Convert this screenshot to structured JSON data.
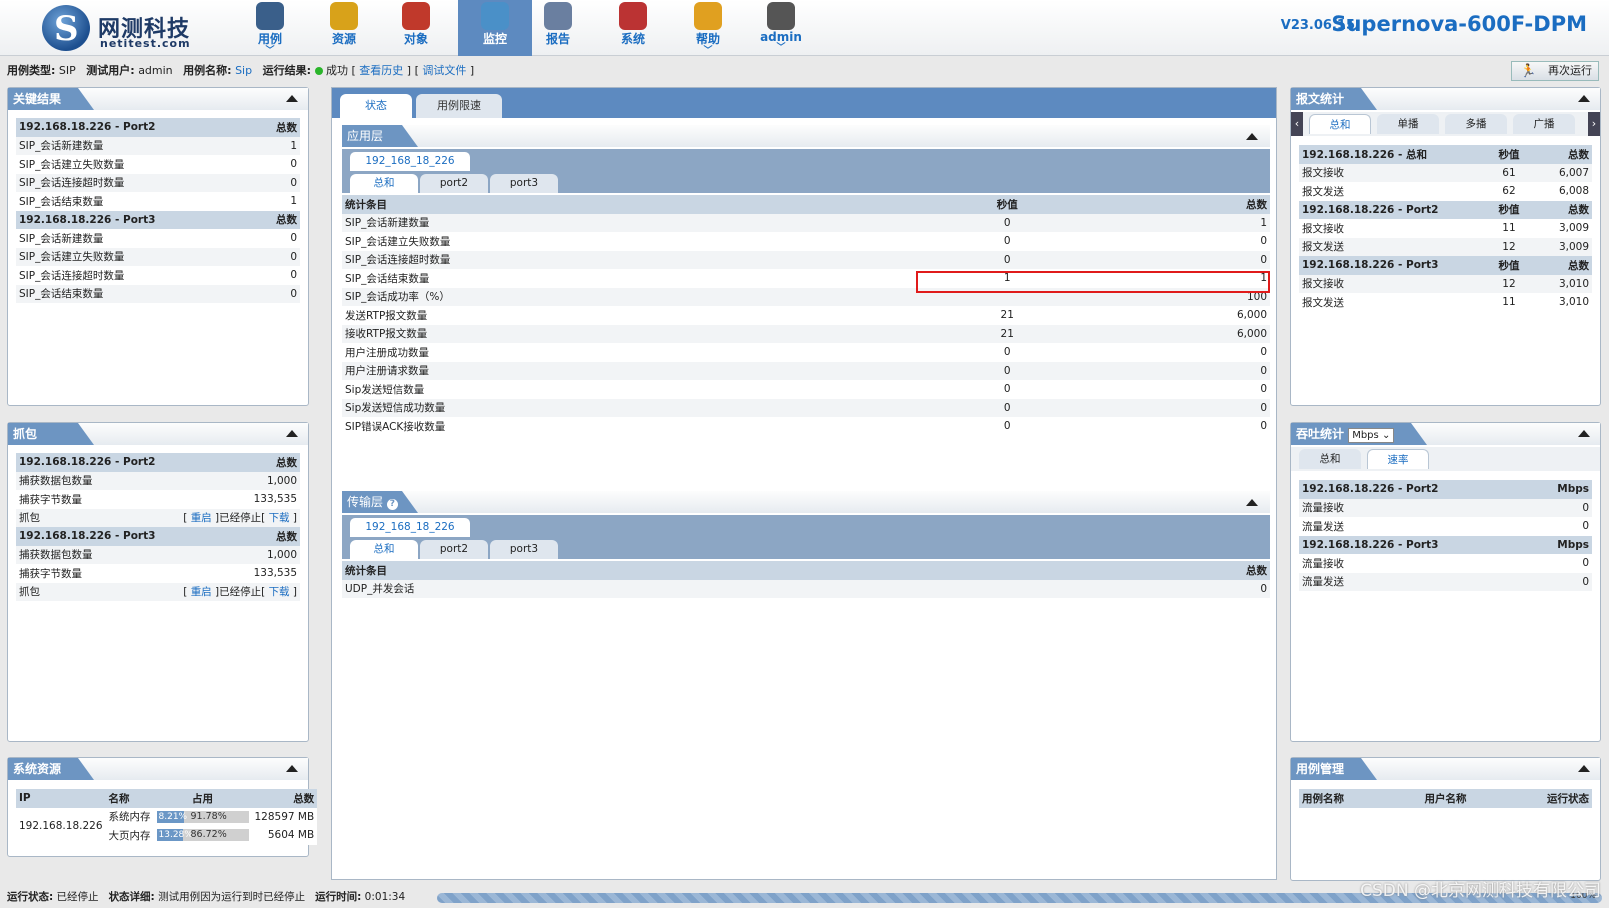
{
  "header": {
    "logo_cn": "网测科技",
    "logo_en": "netitest.com",
    "nav": [
      {
        "label": "用例",
        "icon": "monitor-icon",
        "caret": "﹀"
      },
      {
        "label": "资源",
        "icon": "disc-icon",
        "caret": ""
      },
      {
        "label": "对象",
        "icon": "blocks-icon",
        "caret": ""
      },
      {
        "label": "监控",
        "icon": "radar-icon",
        "caret": ""
      },
      {
        "label": "报告",
        "icon": "report-pen-icon",
        "caret": ""
      },
      {
        "label": "系统",
        "icon": "tools-icon",
        "caret": ""
      },
      {
        "label": "帮助",
        "icon": "help-box-icon",
        "caret": "﹀"
      },
      {
        "label": "admin",
        "icon": "user-icon",
        "caret": "﹀"
      }
    ],
    "version": "V23.06.15",
    "product": "Supernova-600F-DPM"
  },
  "infobar": {
    "type_label": "用例类型:",
    "type_value": "SIP",
    "user_label": "测试用户:",
    "user_value": "admin",
    "name_label": "用例名称:",
    "name_value": "Sip",
    "result_label": "运行结果:",
    "result_value": "成功",
    "history_link": "查看历史",
    "debug_link": "调试文件",
    "rerun": "再次运行"
  },
  "key_results": {
    "title": "关键结果",
    "groups": [
      {
        "head": "192.168.18.226 - Port2",
        "col": "总数",
        "rows": [
          [
            "SIP_会话新建数量",
            "1"
          ],
          [
            "SIP_会话建立失败数量",
            "0"
          ],
          [
            "SIP_会话连接超时数量",
            "0"
          ],
          [
            "SIP_会话结束数量",
            "1"
          ]
        ]
      },
      {
        "head": "192.168.18.226 - Port3",
        "col": "总数",
        "rows": [
          [
            "SIP_会话新建数量",
            "0"
          ],
          [
            "SIP_会话建立失败数量",
            "0"
          ],
          [
            "SIP_会话连接超时数量",
            "0"
          ],
          [
            "SIP_会话结束数量",
            "0"
          ]
        ]
      }
    ]
  },
  "capture": {
    "title": "抓包",
    "groups": [
      {
        "head": "192.168.18.226 - Port2",
        "col": "总数",
        "rows": [
          [
            "捕获数据包数量",
            "1,000"
          ],
          [
            "捕获字节数量",
            "133,535"
          ]
        ],
        "cap_label": "抓包",
        "restart": "重启",
        "stopped": "已经停止",
        "download": "下载"
      },
      {
        "head": "192.168.18.226 - Port3",
        "col": "总数",
        "rows": [
          [
            "捕获数据包数量",
            "1,000"
          ],
          [
            "捕获字节数量",
            "133,535"
          ]
        ],
        "cap_label": "抓包",
        "restart": "重启",
        "stopped": "已经停止",
        "download": "下载"
      }
    ]
  },
  "sysres": {
    "title": "系统资源",
    "cols": [
      "IP",
      "名称",
      "占用",
      "总数"
    ],
    "ip": "192.168.18.226",
    "rows": [
      {
        "name": "系统内存",
        "used": "8.21%",
        "pct": "91.78%",
        "fill": 0.9178,
        "total": "128597 MB"
      },
      {
        "name": "大页内存",
        "used": "13.28%",
        "pct": "86.72%",
        "fill": 0.8672,
        "total": "5604 MB"
      }
    ]
  },
  "center": {
    "tabs": [
      "状态",
      "用例限速"
    ],
    "app": {
      "title": "应用层",
      "ip_tab": "192_168_18_226",
      "port_tabs": [
        "总和",
        "port2",
        "port3"
      ],
      "cols": [
        "统计条目",
        "秒值",
        "总数"
      ],
      "rows": [
        [
          "SIP_会话新建数量",
          "0",
          "1"
        ],
        [
          "SIP_会话建立失败数量",
          "0",
          "0"
        ],
        [
          "SIP_会话连接超时数量",
          "0",
          "0"
        ],
        [
          "SIP_会话结束数量",
          "1",
          "1"
        ],
        [
          "SIP_会话成功率（%）",
          "",
          "100"
        ],
        [
          "发送RTP报文数量",
          "21",
          "6,000"
        ],
        [
          "接收RTP报文数量",
          "21",
          "6,000"
        ],
        [
          "用户注册成功数量",
          "0",
          "0"
        ],
        [
          "用户注册请求数量",
          "0",
          "0"
        ],
        [
          "Sip发送短信数量",
          "0",
          "0"
        ],
        [
          "Sip发送短信成功数量",
          "0",
          "0"
        ],
        [
          "SIP错误ACK接收数量",
          "0",
          "0"
        ]
      ]
    },
    "transport": {
      "title": "传输层",
      "ip_tab": "192_168_18_226",
      "port_tabs": [
        "总和",
        "port2",
        "port3"
      ],
      "cols": [
        "统计条目",
        "总数"
      ],
      "rows": [
        [
          "UDP_并发会话",
          "0"
        ]
      ]
    }
  },
  "packet_stats": {
    "title": "报文统计",
    "tabs": [
      "总和",
      "单播",
      "多播",
      "广播"
    ],
    "groups": [
      {
        "head": "192.168.18.226 - 总和",
        "c1": "秒值",
        "c2": "总数",
        "rows": [
          [
            "报文接收",
            "61",
            "6,007"
          ],
          [
            "报文发送",
            "62",
            "6,008"
          ]
        ]
      },
      {
        "head": "192.168.18.226 - Port2",
        "c1": "秒值",
        "c2": "总数",
        "rows": [
          [
            "报文接收",
            "11",
            "3,009"
          ],
          [
            "报文发送",
            "12",
            "3,009"
          ]
        ]
      },
      {
        "head": "192.168.18.226 - Port3",
        "c1": "秒值",
        "c2": "总数",
        "rows": [
          [
            "报文接收",
            "12",
            "3,010"
          ],
          [
            "报文发送",
            "11",
            "3,010"
          ]
        ]
      }
    ]
  },
  "throughput": {
    "title": "吞吐统计",
    "unit_select": "Mbps",
    "tabs": [
      "总和",
      "速率"
    ],
    "groups": [
      {
        "head": "192.168.18.226 - Port2",
        "col": "Mbps",
        "rows": [
          [
            "流量接收",
            "0"
          ],
          [
            "流量发送",
            "0"
          ]
        ]
      },
      {
        "head": "192.168.18.226 - Port3",
        "col": "Mbps",
        "rows": [
          [
            "流量接收",
            "0"
          ],
          [
            "流量发送",
            "0"
          ]
        ]
      }
    ]
  },
  "case_mgmt": {
    "title": "用例管理",
    "cols": [
      "用例名称",
      "用户名称",
      "运行状态"
    ]
  },
  "status": {
    "run_label": "运行状态:",
    "run_value": "已经停止",
    "detail_label": "状态详细:",
    "detail_value": "测试用例因为运行到时已经停止",
    "time_label": "运行时间:",
    "time_value": "0:01:34",
    "progress": 1.0,
    "progress_text": "100%"
  },
  "watermark": "CSDN @北京网测科技有限公司"
}
